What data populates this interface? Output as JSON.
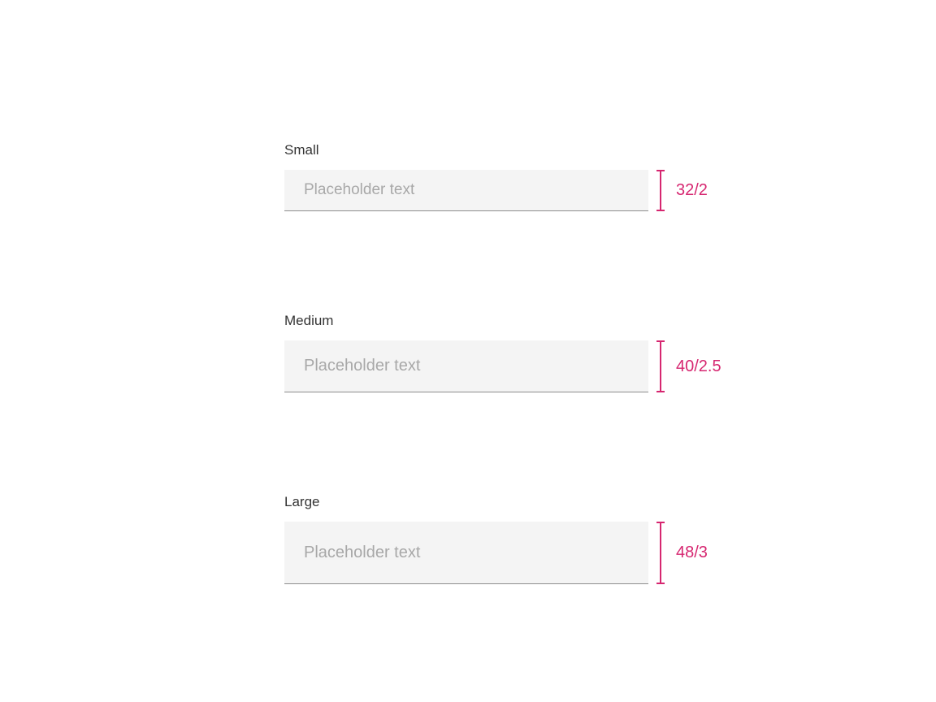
{
  "variants": {
    "small": {
      "label": "Small",
      "placeholder": "Placeholder text",
      "dimension": "32/2"
    },
    "medium": {
      "label": "Medium",
      "placeholder": "Placeholder text",
      "dimension": "40/2.5"
    },
    "large": {
      "label": "Large",
      "placeholder": "Placeholder text",
      "dimension": "48/3"
    }
  }
}
